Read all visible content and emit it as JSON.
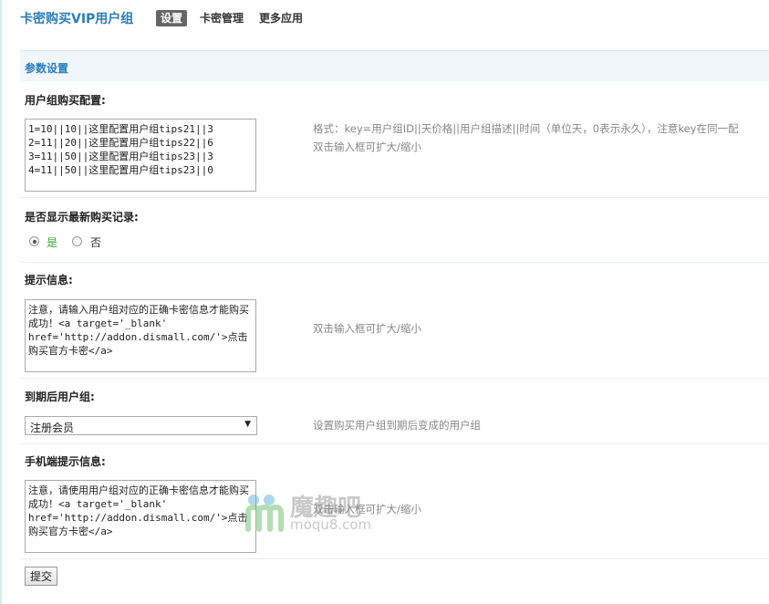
{
  "header": {
    "app_title": "卡密购买VIP用户组",
    "tabs": [
      {
        "label": "设置",
        "active": true
      },
      {
        "label": "卡密管理",
        "active": false
      },
      {
        "label": "更多应用",
        "active": false
      }
    ]
  },
  "section": {
    "title": "参数设置"
  },
  "fields": {
    "buy_config": {
      "label": "用户组购买配置:",
      "value": "1=10||10||这里配置用户组tips21||3\n2=11||20||这里配置用户组tips22||6\n3=11||50||这里配置用户组tips23||3\n4=11||50||这里配置用户组tips23||0",
      "hint_line1": "格式：key=用户组ID||天价格||用户组描述||时间（单位天，0表示永久），注意key在同一配",
      "hint_line2": "双击输入框可扩大/缩小"
    },
    "show_latest": {
      "label": "是否显示最新购买记录:",
      "options": [
        {
          "label": "是",
          "checked": true
        },
        {
          "label": "否",
          "checked": false
        }
      ]
    },
    "tip_info": {
      "label": "提示信息:",
      "value": "注意，请输入用户组对应的正确卡密信息才能购买成功！<a target='_blank' href='http://addon.dismall.com/'>点击购买官方卡密</a>",
      "hint": "双击输入框可扩大/缩小"
    },
    "expire_group": {
      "label": "到期后用户组:",
      "selected": "注册会员",
      "hint": "设置购买用户组到期后变成的用户组"
    },
    "mobile_tip": {
      "label": "手机端提示信息:",
      "value": "注意，请使用用户组对应的正确卡密信息才能购买成功！<a target='_blank' href='http://addon.dismall.com/'>点击购买官方卡密</a>",
      "hint": "双击输入框可扩大/缩小"
    }
  },
  "submit_label": "提交",
  "watermark": {
    "brand": "魔趣吧",
    "url": "moqu8.com"
  },
  "colors": {
    "accent": "#2b7dbc",
    "active_tab_bg": "#666666",
    "radio_on_label": "#3aa43a"
  }
}
